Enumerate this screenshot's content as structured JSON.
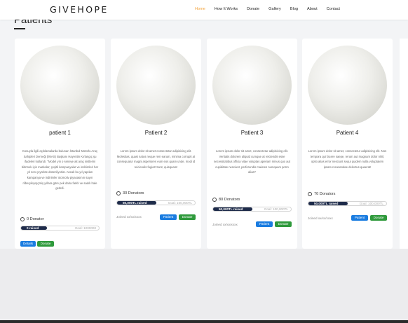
{
  "brand": "GIVEHOPE",
  "nav": [
    "Home",
    "How It Works",
    "Donate",
    "Gallery",
    "Blog",
    "About",
    "Contact"
  ],
  "section_title": "Patients",
  "cards": [
    {
      "name": "patient 1",
      "description": "Konuyla ilgili açıklamalarda bulunan İstanbul Motorlu Araç Sahipleri Derneği (İMAS) Başkanı Hayrettin Kırlangıç şu ifadeleri kullandı: \"Model yılı o seneye ait araç sistlerini bitirmek için markalar; çeşitli kampanyalar ve indirimleri her yıl son çeyrekte düzenliyorlar. Ancak bu yıl yapılan kampanya ve indirimler otomotiv piyasasının sayın rilberyikçeşçmiş yıllara göre pek daha farklı ve sadık hale getirdi.",
      "donators": "0 Donator",
      "raised": "0 raised",
      "goal": "Goal: 1000000",
      "btn1": "Details",
      "btn2": "Donate",
      "progress_fraction": 0.33
    },
    {
      "name": "Patient 2",
      "description": "Lorem ipsum dolor sit amet consectetur adipisicing elit. Molestias, quasi natus neque rem earum, minima corrupti at consequatur magni asperiores eum eos quam unde, modi id reiciendis fugiat! Sunt, quisquam!",
      "donators": "30 Donators",
      "raised": "50,000TL raised",
      "goal": "Goal: 100,000TL",
      "joined": "Joined xx/xx/xxxx",
      "btn1": "Patient",
      "btn2": "Donate",
      "progress_fraction": 0.5
    },
    {
      "name": "Patient 3",
      "description": "Lorem ipsum dolor sit amet, consectetur adipisicing elit. Veritatis dolorem aliquid cumque at reiciendis esse necessitatibus officia vitae voluptas aperiam minus quo aut cupiditate nesciunt, perferendis maiores numquam porro alias?",
      "donators": "80 Donators",
      "raised": "50,000TL raised",
      "goal": "Goal: 100,000TL",
      "joined": "Joined xx/xx/xxxx",
      "btn1": "Patient",
      "btn2": "Donate",
      "progress_fraction": 0.5
    },
    {
      "name": "Patient 4",
      "description": "Lorem ipsum dolor sit amet, consectetur adipisicing elit. Non tempora qui facere saepe, rerum aut magnam dolor nihil, optio alias error nesciunt sequi quidem nulla voluptatem ipsam recusandae delectus quaerat!",
      "donators": "70 Donators",
      "raised": "50,000TL raised",
      "goal": "Goal: 100,000TL",
      "joined": "Joined xx/xx/xxxx",
      "btn1": "Patient",
      "btn2": "Donate",
      "progress_fraction": 0.5
    }
  ],
  "colors": {
    "accent": "#f3a23a",
    "progress_fill": "#1e2b4a",
    "button_blue": "#1a7ce0",
    "button_green": "#2f9a3c"
  }
}
